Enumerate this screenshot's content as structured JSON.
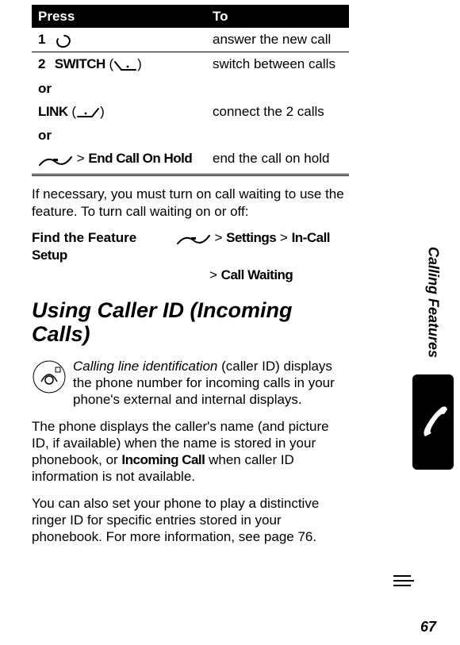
{
  "tableHeader": {
    "press": "Press",
    "to": "To"
  },
  "steps": {
    "s1_num": "1",
    "s1_action": "answer the new call",
    "s2_num": "2",
    "s2_switch": "SWITCH",
    "s2_switch_action": "switch between calls",
    "or": "or",
    "s2_link": "LINK",
    "s2_link_action": "connect the 2 calls",
    "s2_end": "End Call On Hold",
    "s2_end_action": "end the call on hold"
  },
  "para1": "If necessary, you must turn on call waiting to use the feature. To turn call waiting on or off:",
  "findFeature": "Find the Feature",
  "path_settings": "Settings",
  "path_incall": "In-Call Setup",
  "path_cw": "Call Waiting",
  "gt": ">",
  "sectionTitle": "Using Caller ID (Incoming Calls)",
  "para2a": "Calling line identification",
  "para2b": " (caller ID) displays the phone number for incoming calls in your phone's external and internal displays.",
  "para3a": "The phone displays the caller's name (and picture ID, if available) when the name is stored in your phonebook, or ",
  "para3b": "Incoming Call",
  "para3c": " when caller ID information is not available.",
  "para4": "You can also set your phone to play a distinctive ringer ID for specific entries stored in your phonebook. For more information, see page 76.",
  "sideLabel": "Calling Features",
  "pageNumber": "67"
}
